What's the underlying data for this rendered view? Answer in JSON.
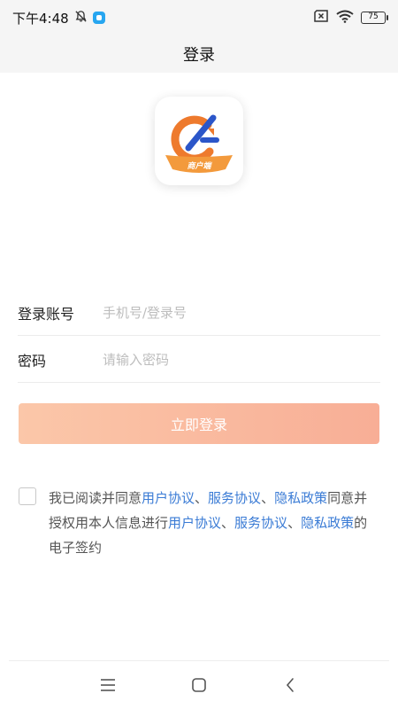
{
  "status_bar": {
    "time": "下午4:48",
    "battery_level": "75",
    "icons": [
      "bell-off-icon",
      "app-notification-icon",
      "sim-off-icon",
      "wifi-icon",
      "battery-icon"
    ]
  },
  "header": {
    "title": "登录"
  },
  "logo": {
    "text": "商户端",
    "colors": {
      "orange": "#ee7a2d",
      "blue": "#2b56c9",
      "band": "#f39a3c"
    }
  },
  "form": {
    "account": {
      "label": "登录账号",
      "placeholder": "手机号/登录号",
      "value": ""
    },
    "password": {
      "label": "密码",
      "placeholder": "请输入密码",
      "value": ""
    }
  },
  "login_button": {
    "label": "立即登录"
  },
  "agreement": {
    "checked": false,
    "text1": "我已阅读并同意",
    "link_user": "用户协议",
    "sep1": "、",
    "link_service": "服务协议",
    "sep2": "、",
    "link_privacy": "隐私政策",
    "text2": "同意并授权用本人信息进行",
    "link_user2": "用户协议",
    "sep3": "、",
    "link_service2": "服务协议",
    "sep4": "、",
    "link_privacy2": "隐私政策",
    "text3": "的电子签约"
  },
  "colors": {
    "link": "#3a7bd5",
    "button_start": "#fbc7a9",
    "button_end": "#f8ae96",
    "header_bg": "#f5f5f5"
  },
  "nav": {
    "icons": [
      "menu-icon",
      "home-icon",
      "back-icon"
    ]
  }
}
